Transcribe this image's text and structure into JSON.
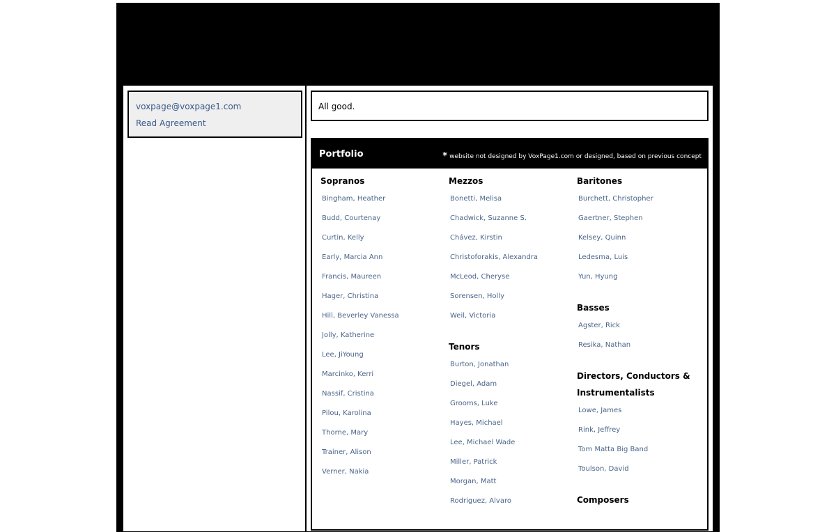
{
  "sidebar": {
    "email": "voxpage@voxpage1.com",
    "agreement_link": "Read Agreement"
  },
  "message": {
    "text": "All good."
  },
  "portfolio": {
    "title": "Portfolio",
    "note_star": "*",
    "note_text": "website not designed by VoxPage1.com or designed, based on previous concept"
  },
  "columns": [
    {
      "categories": [
        {
          "title": "Sopranos",
          "names": [
            "Bingham, Heather",
            "Budd, Courtenay",
            "Curtin, Kelly",
            "Early, Marcia Ann",
            "Francis, Maureen",
            "Hager, Christina",
            "Hill, Beverley Vanessa",
            "Jolly, Katherine",
            "Lee, JiYoung",
            "Marcinko, Kerri",
            "Nassif, Cristina",
            "Pilou, Karolina",
            "Thorne, Mary",
            "Trainer, Alison",
            "Verner, Nakia"
          ]
        }
      ]
    },
    {
      "categories": [
        {
          "title": "Mezzos",
          "names": [
            "Bonetti, Melisa",
            "Chadwick, Suzanne S.",
            "Chávez, Kirstin",
            "Christoforakis, Alexandra",
            "McLeod, Cheryse",
            "Sorensen, Holly",
            "Weil, Victoria"
          ]
        },
        {
          "title": "Tenors",
          "names": [
            "Burton, Jonathan",
            "Diegel, Adam",
            "Grooms, Luke",
            "Hayes, Michael",
            "Lee, Michael Wade",
            "Miller, Patrick",
            "Morgan, Matt",
            "Rodriguez, Alvaro"
          ]
        }
      ]
    },
    {
      "categories": [
        {
          "title": "Baritones",
          "names": [
            "Burchett, Christopher",
            "Gaertner, Stephen",
            "Kelsey, Quinn",
            "Ledesma, Luis",
            "Yun, Hyung"
          ]
        },
        {
          "title": "Basses",
          "names": [
            "Agster, Rick",
            "Resika, Nathan"
          ]
        },
        {
          "title": "Directors, Conductors & Instrumentalists",
          "names": [
            "Lowe, James",
            "Rink, Jeffrey",
            "Tom Matta Big Band",
            "Toulson, David"
          ]
        },
        {
          "title": "Composers",
          "names": []
        }
      ]
    }
  ]
}
